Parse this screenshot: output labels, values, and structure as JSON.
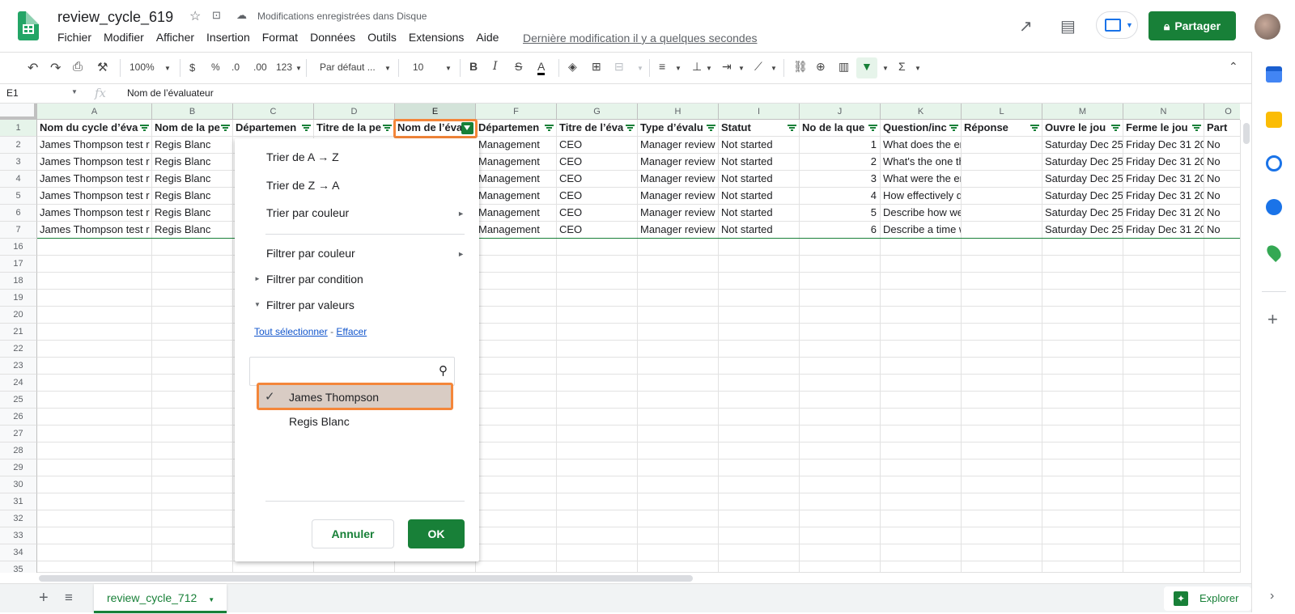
{
  "doc": {
    "title": "review_cycle_619",
    "saved_status": "Modifications enregistrées dans Disque",
    "last_modified": "Dernière modification il y a quelques secondes",
    "share_label": "Partager"
  },
  "menu": [
    "Fichier",
    "Modifier",
    "Afficher",
    "Insertion",
    "Format",
    "Données",
    "Outils",
    "Extensions",
    "Aide"
  ],
  "toolbar": {
    "zoom": "100%",
    "currency": "$",
    "percent": "%",
    "dec_decrease": ".0",
    "dec_increase": ".00",
    "format_more": "123",
    "font": "Par défaut ...",
    "font_size": "10"
  },
  "formula_bar": {
    "cell_ref": "E1",
    "fx": "fx",
    "content": "Nom de l’évaluateur"
  },
  "columns": [
    "A",
    "B",
    "C",
    "D",
    "E",
    "F",
    "G",
    "H",
    "I",
    "J",
    "K",
    "L",
    "M",
    "N",
    "O"
  ],
  "rows": [
    {
      "num": "1",
      "cells": [
        "Nom du cycle d’éva",
        "Nom de la pe",
        "Départemen",
        "Titre de la pe",
        "Nom de l’éva",
        "Départemen",
        "Titre de l’éva",
        "Type d’évalu",
        "Statut",
        "No de la que",
        "Question/inc",
        "Réponse",
        "Ouvre le jou",
        "Ferme le jou",
        "Part"
      ]
    },
    {
      "num": "2",
      "cells": [
        "James Thompson test r",
        "Regis Blanc",
        "",
        "",
        "",
        "Management",
        "CEO",
        "Manager review",
        "Not started",
        "1",
        "What does the employee do well?",
        "",
        "Saturday Dec 25",
        "Friday Dec 31 20",
        "No"
      ]
    },
    {
      "num": "3",
      "cells": [
        "James Thompson test r",
        "Regis Blanc",
        "",
        "",
        "",
        "Management",
        "CEO",
        "Manager review",
        "Not started",
        "2",
        "What's the one thing the employe",
        "",
        "Saturday Dec 25",
        "Friday Dec 31 20",
        "No"
      ]
    },
    {
      "num": "4",
      "cells": [
        "James Thompson test r",
        "Regis Blanc",
        "",
        "",
        "",
        "Management",
        "CEO",
        "Manager review",
        "Not started",
        "3",
        "What were the employee's goals a",
        "",
        "Saturday Dec 25",
        "Friday Dec 31 20",
        "No"
      ]
    },
    {
      "num": "5",
      "cells": [
        "James Thompson test r",
        "Regis Blanc",
        "",
        "",
        "",
        "Management",
        "CEO",
        "Manager review",
        "Not started",
        "4",
        "How effectively does the employe",
        "",
        "Saturday Dec 25",
        "Friday Dec 31 20",
        "No"
      ]
    },
    {
      "num": "6",
      "cells": [
        "James Thompson test r",
        "Regis Blanc",
        "",
        "",
        "",
        "Management",
        "CEO",
        "Manager review",
        "Not started",
        "5",
        "Describe how well the employee c",
        "",
        "Saturday Dec 25",
        "Friday Dec 31 20",
        "No"
      ]
    },
    {
      "num": "7",
      "cells": [
        "James Thompson test r",
        "Regis Blanc",
        "",
        "",
        "",
        "Management",
        "CEO",
        "Manager review",
        "Not started",
        "6",
        "Describe a time when the employ",
        "",
        "Saturday Dec 25",
        "Friday Dec 31 20",
        "No"
      ]
    }
  ],
  "empty_rows": [
    "16",
    "17",
    "18",
    "19",
    "20",
    "21",
    "22",
    "23",
    "24",
    "25",
    "26",
    "27",
    "28",
    "29",
    "30",
    "31",
    "32",
    "33",
    "34",
    "35"
  ],
  "filter_menu": {
    "sort_az": "Trier de A → Z",
    "sort_za": "Trier de Z → A",
    "sort_color": "Trier par couleur",
    "filter_color": "Filtrer par couleur",
    "filter_condition": "Filtrer par condition",
    "filter_values": "Filtrer par valeurs",
    "select_all": "Tout sélectionner",
    "separator": " - ",
    "clear": "Effacer",
    "search_placeholder": "",
    "values": [
      {
        "label": "James Thompson",
        "checked": true
      },
      {
        "label": "Regis Blanc",
        "checked": false
      }
    ],
    "cancel": "Annuler",
    "ok": "OK"
  },
  "sheet_tab": "review_cycle_712",
  "explore_label": "Explorer",
  "colors": {
    "accent_green": "#188038",
    "highlight_orange": "#f4863a",
    "link_blue": "#1155cc"
  }
}
